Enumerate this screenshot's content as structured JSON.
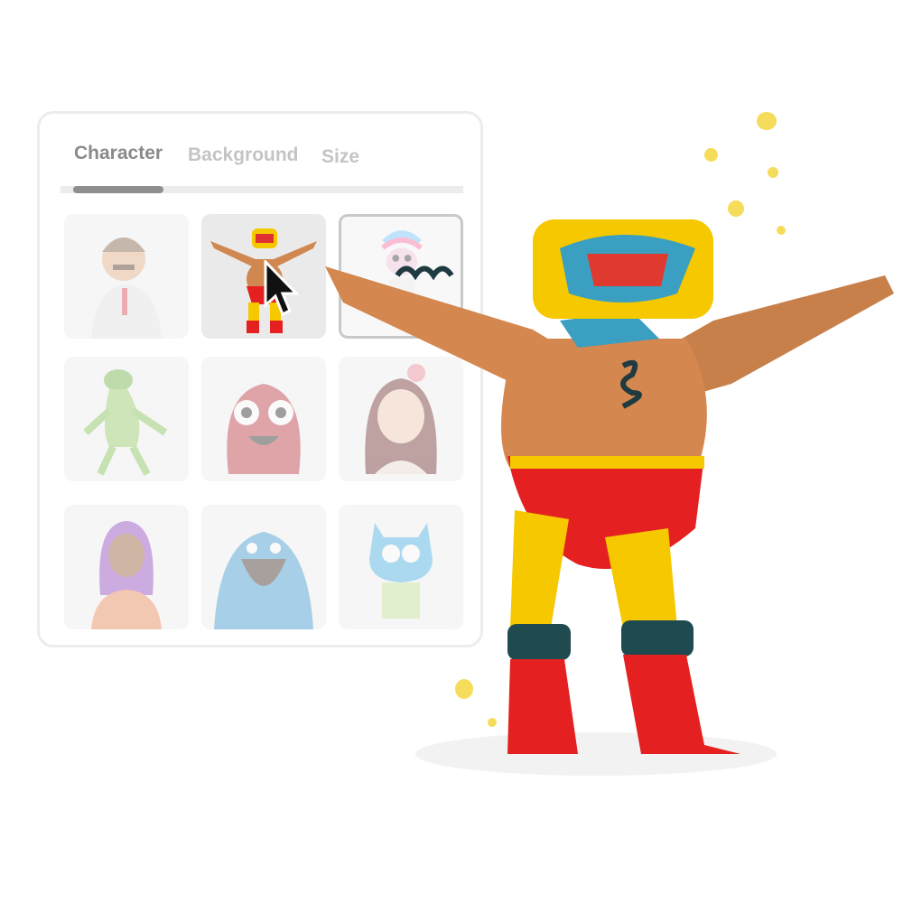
{
  "panel": {
    "tabs": [
      {
        "label": "Character",
        "active": true
      },
      {
        "label": "Background",
        "active": false
      },
      {
        "label": "Size",
        "active": false
      }
    ],
    "characters": [
      {
        "name": "doctor",
        "state": "normal"
      },
      {
        "name": "wrestler",
        "state": "hover"
      },
      {
        "name": "unicorn",
        "state": "selected"
      },
      {
        "name": "frog",
        "state": "normal"
      },
      {
        "name": "red-monster",
        "state": "normal"
      },
      {
        "name": "anime-girl",
        "state": "normal"
      },
      {
        "name": "purple-hair-woman",
        "state": "normal"
      },
      {
        "name": "blue-bearded-monster",
        "state": "normal"
      },
      {
        "name": "blue-cat",
        "state": "normal"
      }
    ]
  },
  "colors": {
    "accent_dot": "#f5dc5a",
    "tab_active": "#8a8a8a",
    "tab_inactive": "#c4c4c4"
  },
  "icons": {
    "cursor": "arrow-cursor-icon"
  }
}
